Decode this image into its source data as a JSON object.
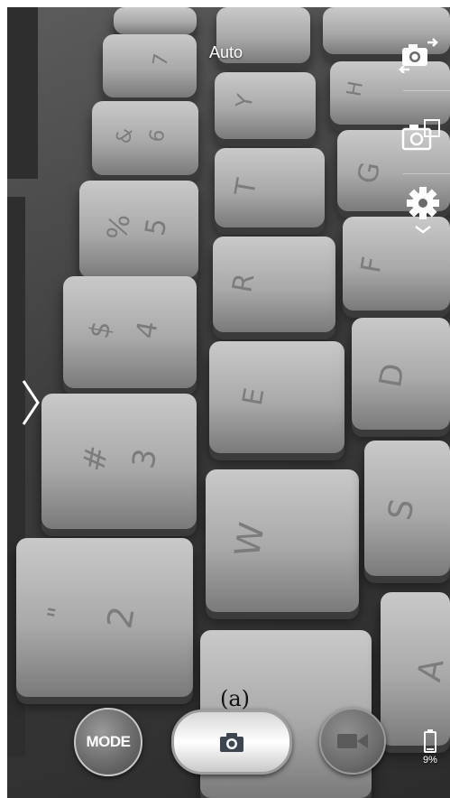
{
  "app": {
    "scene_mode": "Auto"
  },
  "viewfinder": {
    "subject": "keyboard",
    "key_legends": [
      "7",
      "&",
      "6",
      "%",
      "5",
      "$",
      "4",
      "#",
      "3",
      "\"",
      "2",
      "Y",
      "T",
      "R",
      "E",
      "W",
      "H",
      "G",
      "F",
      "D",
      "S",
      "A"
    ]
  },
  "side_controls": {
    "switch_camera_icon": "switch-camera-icon",
    "camera_settings_icon": "camera-icon",
    "settings_icon": "gear-icon"
  },
  "bottom_controls": {
    "mode_label": "MODE",
    "shutter_icon": "camera-icon",
    "video_icon": "video-camera-icon"
  },
  "battery": {
    "level_label": "9%"
  },
  "annotation": "(a)",
  "colors": {
    "overlay_text": "#ffffff",
    "key_top": "#c9c9c9",
    "shutter_icon": "#3c4550"
  }
}
